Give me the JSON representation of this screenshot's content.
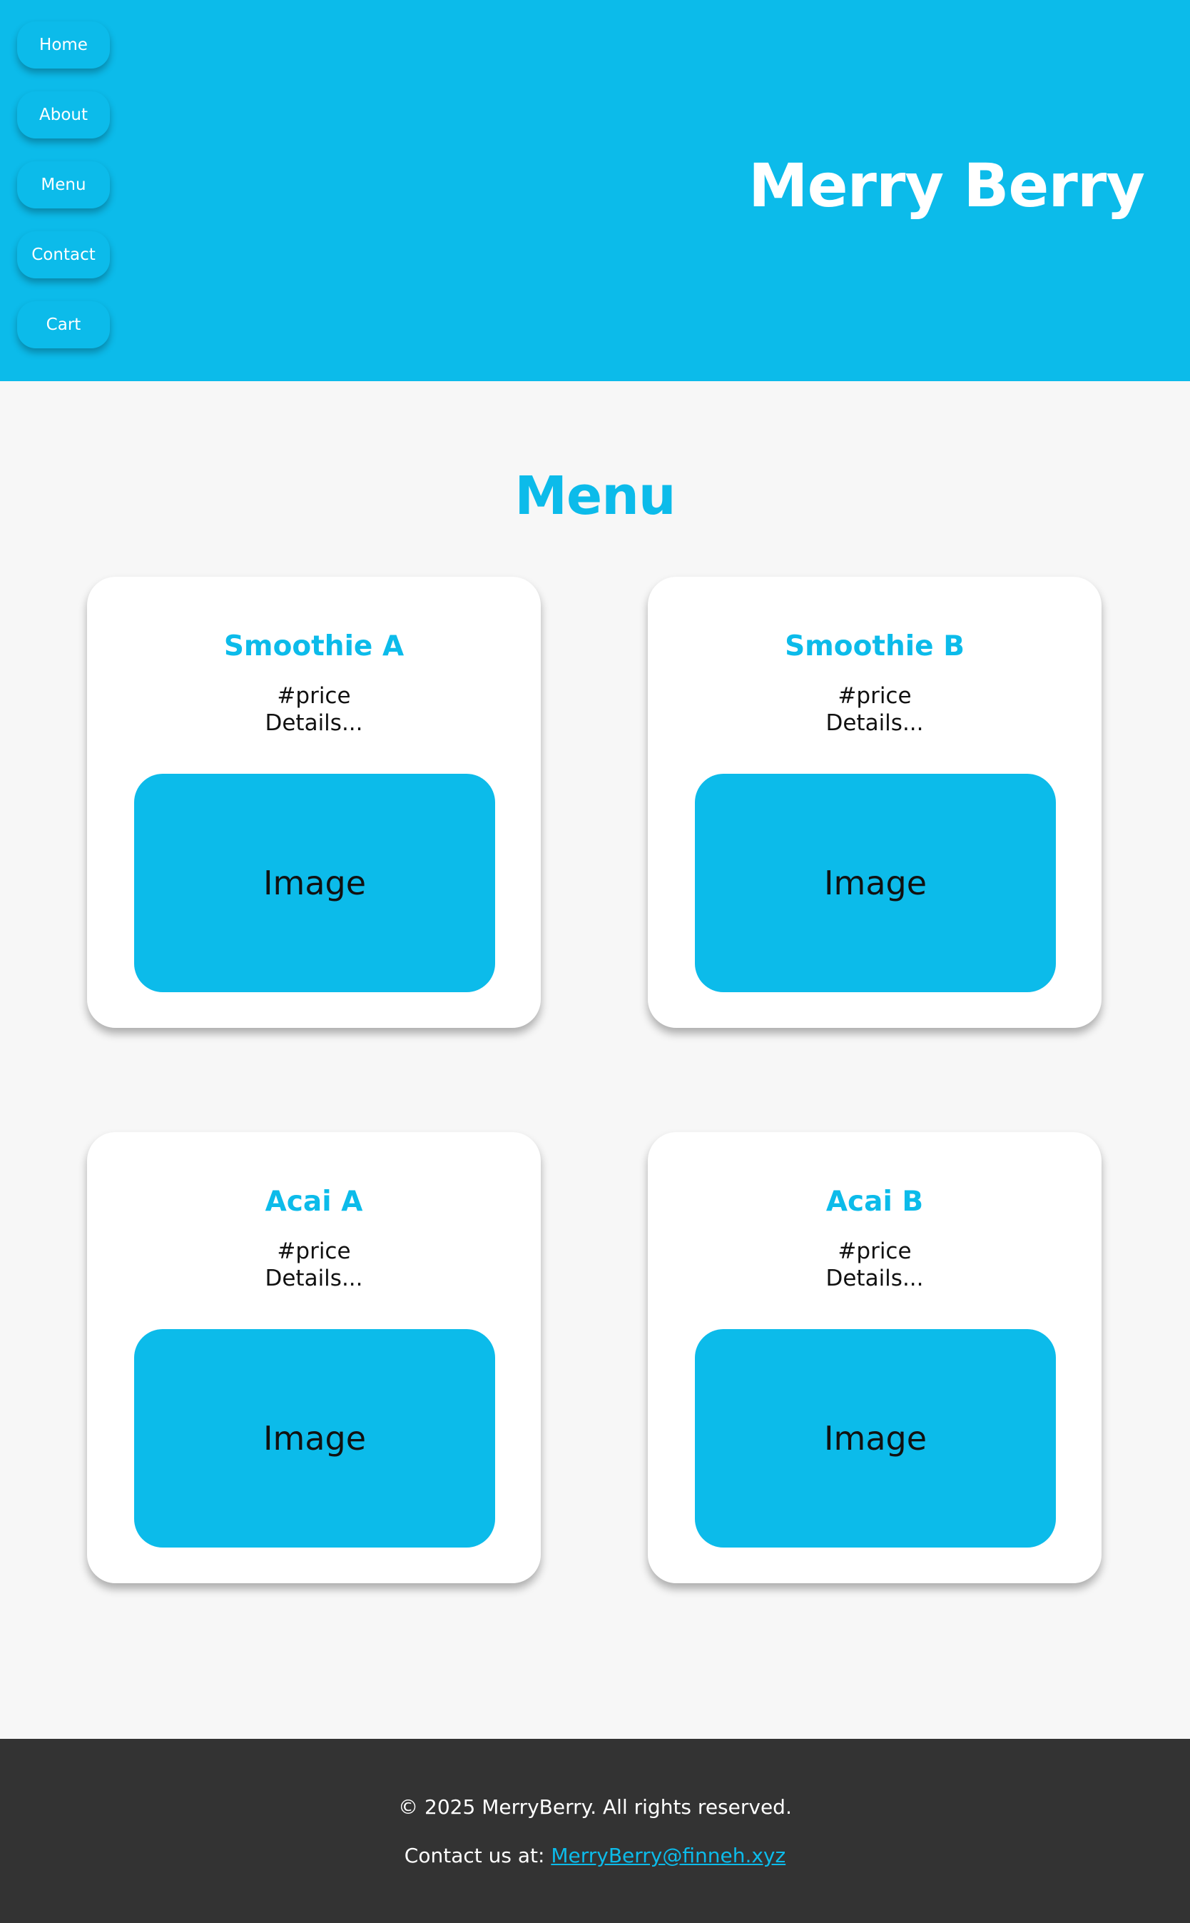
{
  "colors": {
    "accent": "#0cbbea",
    "page_background": "#f7f7f7",
    "card_background": "#ffffff",
    "footer_background": "#333333",
    "text_dark": "#111111",
    "text_light": "#ffffff"
  },
  "header": {
    "brand": "Merry Berry",
    "nav": {
      "home": "Home",
      "about": "About",
      "menu": "Menu",
      "contact": "Contact",
      "cart": "Cart"
    }
  },
  "main": {
    "title": "Menu",
    "items": [
      {
        "name": "Smoothie A",
        "price": "#price",
        "details": "Details...",
        "image_label": "Image"
      },
      {
        "name": "Smoothie B",
        "price": "#price",
        "details": "Details...",
        "image_label": "Image"
      },
      {
        "name": "Acai A",
        "price": "#price",
        "details": "Details...",
        "image_label": "Image"
      },
      {
        "name": "Acai B",
        "price": "#price",
        "details": "Details...",
        "image_label": "Image"
      }
    ]
  },
  "footer": {
    "copyright": "© 2025 MerryBerry. All rights reserved.",
    "contact_prefix": "Contact us at: ",
    "contact_email": "MerryBerry@finneh.xyz"
  }
}
